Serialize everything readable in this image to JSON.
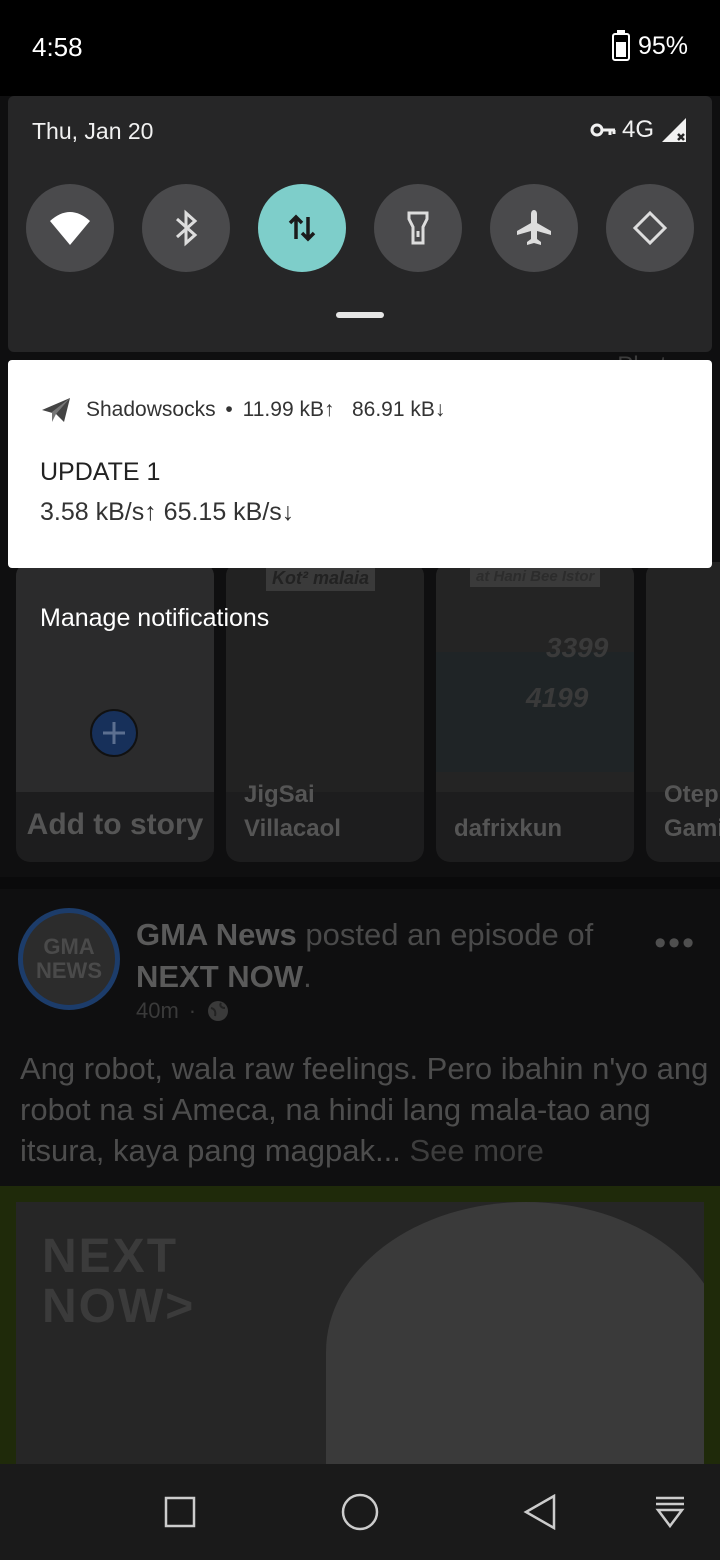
{
  "status_bar": {
    "time": "4:58",
    "battery": "95%"
  },
  "quick_settings": {
    "date": "Thu, Jan 20",
    "network": "4G",
    "signal_badge": "4G",
    "tiles": [
      {
        "id": "wifi",
        "icon": "wifi-icon",
        "active": false
      },
      {
        "id": "bluetooth",
        "icon": "bluetooth-icon",
        "active": false
      },
      {
        "id": "mobile-data",
        "icon": "data-arrows-icon",
        "active": true
      },
      {
        "id": "flashlight",
        "icon": "flashlight-icon",
        "active": false
      },
      {
        "id": "airplane",
        "icon": "airplane-icon",
        "active": false
      },
      {
        "id": "auto-rotate",
        "icon": "rotate-icon",
        "active": false
      }
    ],
    "accent_color": "#7ececa"
  },
  "notification": {
    "app_name": "Shadowsocks",
    "separator": "•",
    "upload_total": "11.99 kB↑",
    "download_total": "86.91 kB↓",
    "title": "UPDATE 1",
    "speeds": "3.58 kB/s↑ 65.15 kB/s↓"
  },
  "feed": {
    "photo_label": "Photo",
    "manage_notifications": "Manage notifications",
    "stories": [
      {
        "name": "Add to story"
      },
      {
        "name": "JigSai Villacaol",
        "caption": "Kot² malaia"
      },
      {
        "name": "dafrixkun",
        "caption": "at Hani Bee Istor"
      },
      {
        "name": "Otep Gami"
      }
    ],
    "post": {
      "author": "GMA News",
      "action": "posted an episode of",
      "show": "NEXT NOW",
      "time": "40m",
      "text": "Ang robot, wala raw feelings. Pero ibahin n'yo ang robot na si Ameca, na hindi lang mala-tao ang itsura, kaya pang magpak...",
      "see_more": "See more",
      "media_title": "NEXT NOW>",
      "avatar_text": "GMA NEWS"
    }
  },
  "navbar": {
    "buttons": [
      "recents-icon",
      "home-icon",
      "back-icon",
      "notification-shade-icon"
    ]
  }
}
